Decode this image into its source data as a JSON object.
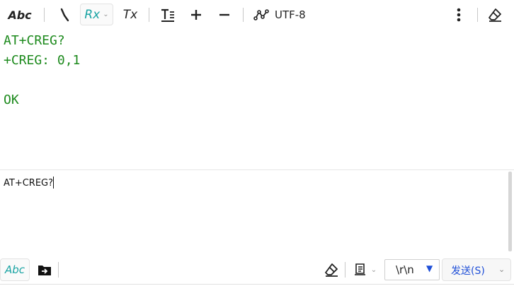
{
  "toolbar": {
    "abc_label": "Abc",
    "rx_label": "Rx",
    "tx_label": "Tx",
    "encoding": "UTF-8",
    "icons": [
      "timestamp-icon",
      "format-icon",
      "plus-icon",
      "minus-icon",
      "chart-icon",
      "more-icon",
      "eraser-icon"
    ]
  },
  "receive": {
    "lines": [
      "AT+CREG?",
      "+CREG: 0,1",
      "",
      "OK"
    ],
    "text_color": "#1d8a1d"
  },
  "send": {
    "input_value": "AT+CREG?"
  },
  "bottombar": {
    "abc_label": "Abc",
    "line_ending": "\\r\\n",
    "send_label": "发送(S)",
    "icons": [
      "export-icon",
      "eraser-icon",
      "document-icon"
    ]
  },
  "colors": {
    "accent_teal": "#18a3a3",
    "accent_blue": "#1f4fd8"
  }
}
